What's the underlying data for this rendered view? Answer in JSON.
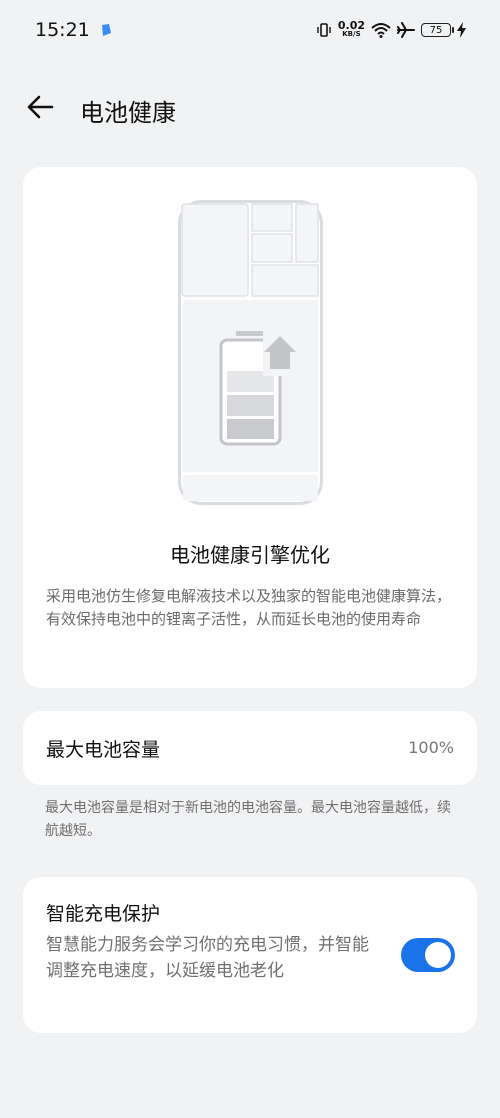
{
  "status_bar": {
    "time": "15:21",
    "net_speed_value": "0.02",
    "net_speed_unit": "KB/S",
    "battery_level": "75",
    "icons": [
      "app-notification-icon",
      "vibrate-icon",
      "wifi-icon",
      "airplane-icon",
      "battery-icon",
      "charging-bolt-icon"
    ]
  },
  "header": {
    "back_icon": "back-arrow-icon",
    "title": "电池健康"
  },
  "hero": {
    "illustration": "phone-battery-illustration",
    "title": "电池健康引擎优化",
    "description": "采用电池仿生修复电解液技术以及独家的智能电池健康算法，有效保持电池中的锂离子活性，从而延长电池的使用寿命"
  },
  "capacity": {
    "label": "最大电池容量",
    "value": "100%",
    "note": "最大电池容量是相对于新电池的电池容量。最大电池容量越低，续航越短。"
  },
  "smart_charging": {
    "title": "智能充电保护",
    "description": "智慧能力服务会学习你的充电习惯，并智能调整充电速度，以延缓电池老化",
    "enabled": true
  },
  "colors": {
    "background": "#f1f2f4",
    "card": "#ffffff",
    "accent": "#1a73e8",
    "text_secondary": "#6b6b6b"
  }
}
